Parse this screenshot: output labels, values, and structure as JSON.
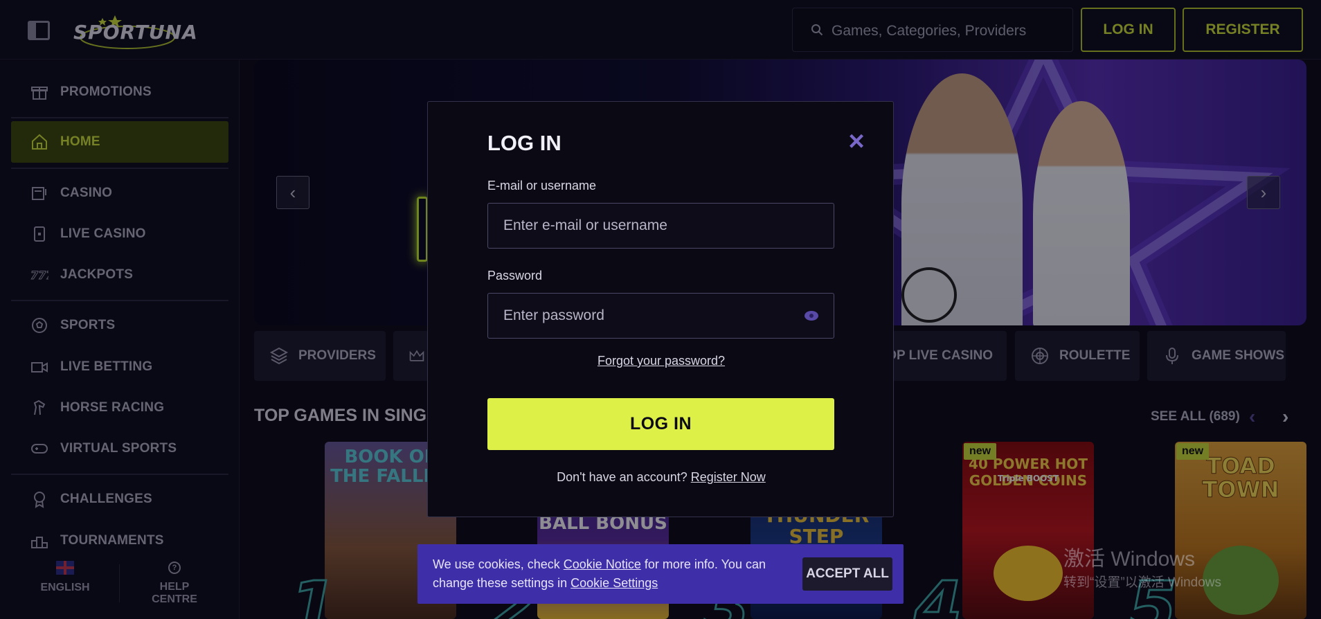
{
  "header": {
    "logo_text": "SPORTUNA",
    "search_placeholder": "Games, Categories, Providers",
    "login_label": "LOG IN",
    "register_label": "REGISTER"
  },
  "sidebar": {
    "items": [
      {
        "label": "PROMOTIONS",
        "icon": "gift-icon"
      },
      {
        "label": "HOME",
        "icon": "home-icon",
        "active": true
      },
      {
        "label": "CASINO",
        "icon": "slot-machine-icon"
      },
      {
        "label": "LIVE CASINO",
        "icon": "card-icon"
      },
      {
        "label": "JACKPOTS",
        "icon": "jackpot-icon"
      },
      {
        "label": "SPORTS",
        "icon": "soccer-ball-icon"
      },
      {
        "label": "LIVE BETTING",
        "icon": "video-camera-icon"
      },
      {
        "label": "HORSE RACING",
        "icon": "horse-icon"
      },
      {
        "label": "VIRTUAL SPORTS",
        "icon": "gamepad-icon"
      },
      {
        "label": "CHALLENGES",
        "icon": "medal-icon"
      },
      {
        "label": "TOURNAMENTS",
        "icon": "podium-icon"
      }
    ],
    "language_label": "ENGLISH",
    "help_label": "HELP CENTRE"
  },
  "categories": [
    {
      "label": "PROVIDERS",
      "icon": "layers-icon"
    },
    {
      "label": "",
      "icon": "crown-icon"
    },
    {
      "label": "TOP LIVE CASINO",
      "icon": "live-icon"
    },
    {
      "label": "ROULETTE",
      "icon": "roulette-icon"
    },
    {
      "label": "GAME SHOWS",
      "icon": "microphone-icon"
    }
  ],
  "games_section": {
    "title": "TOP GAMES IN SINGA",
    "see_all": "SEE ALL (689)",
    "games": [
      {
        "title": "BOOK OF THE FALLEN",
        "rank": "1"
      },
      {
        "title": "BALL BONUS",
        "rank": "2"
      },
      {
        "title": "THUNDER STEP",
        "rank": "3"
      },
      {
        "title": "40 POWER HOT GOLDEN COINS",
        "subtitle": "Triple BOOST",
        "badge": "new",
        "rank": "4"
      },
      {
        "title": "TOAD TOWN",
        "badge": "new",
        "rank": "5"
      }
    ]
  },
  "login_modal": {
    "title": "LOG IN",
    "email_label": "E-mail or username",
    "email_placeholder": "Enter e-mail or username",
    "password_label": "Password",
    "password_placeholder": "Enter password",
    "forgot_link": "Forgot your password?",
    "submit_label": "LOG IN",
    "no_account_text": "Don't have an account?",
    "register_link": "Register Now"
  },
  "cookie_banner": {
    "text_1": "We use cookies, check",
    "cookie_notice_link": "Cookie Notice",
    "text_2": "for more info. You can change these settings in",
    "cookie_settings_link": "Cookie Settings",
    "accept_label": "ACCEPT ALL"
  },
  "watermark": {
    "title": "激活 Windows",
    "subtitle": "转到“设置”以激活 Windows"
  },
  "colors": {
    "accent": "#dcf048",
    "modal_close": "#7a68c9",
    "cookie_bg": "#3e2fa8"
  }
}
